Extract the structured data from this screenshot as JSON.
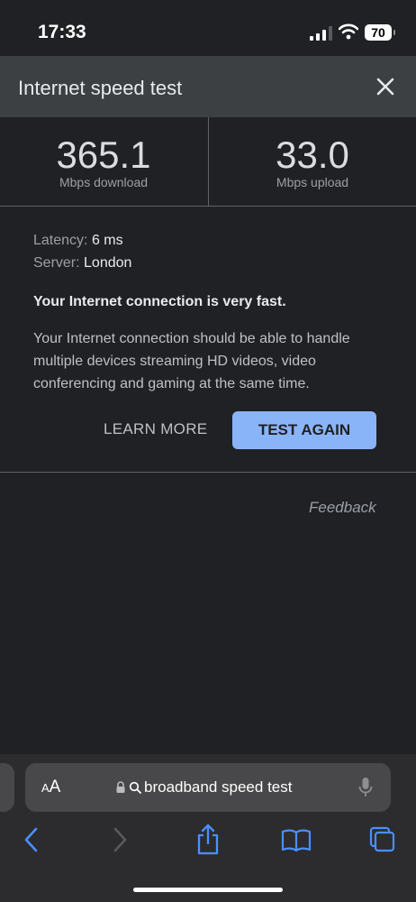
{
  "status_bar": {
    "time": "17:33",
    "battery": "70"
  },
  "header": {
    "title": "Internet speed test"
  },
  "results": {
    "download_value": "365.1",
    "download_label": "Mbps download",
    "upload_value": "33.0",
    "upload_label": "Mbps upload"
  },
  "details": {
    "latency_label": "Latency:",
    "latency_value": "6 ms",
    "server_label": "Server:",
    "server_value": "London",
    "verdict": "Your Internet connection is very fast.",
    "description": "Your Internet connection should be able to handle multiple devices streaming HD videos, video conferencing and gaming at the same time."
  },
  "actions": {
    "learn_more": "LEARN MORE",
    "test_again": "TEST AGAIN"
  },
  "feedback": "Feedback",
  "browser": {
    "aa_small": "A",
    "aa_large": "A",
    "url_text": "broadband speed test"
  },
  "colors": {
    "accent": "#8ab4f8",
    "background": "#202124",
    "header": "#3c4043"
  },
  "icons": [
    "signal-icon",
    "wifi-icon",
    "battery-icon",
    "close-icon",
    "lock-icon",
    "search-icon",
    "microphone-icon",
    "back-icon",
    "forward-icon",
    "share-icon",
    "bookmarks-icon",
    "tabs-icon"
  ]
}
